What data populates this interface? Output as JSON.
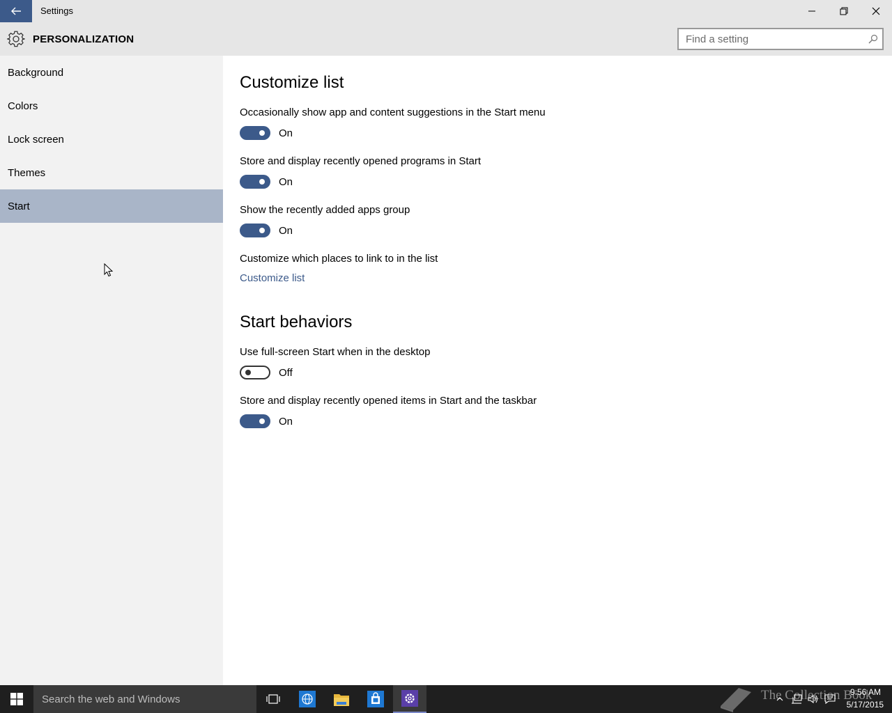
{
  "window": {
    "title": "Settings"
  },
  "header": {
    "title": "PERSONALIZATION",
    "search_placeholder": "Find a setting"
  },
  "sidebar": {
    "items": [
      {
        "label": "Background"
      },
      {
        "label": "Colors"
      },
      {
        "label": "Lock screen"
      },
      {
        "label": "Themes"
      },
      {
        "label": "Start",
        "selected": true
      }
    ]
  },
  "main": {
    "customize_list": {
      "title": "Customize list",
      "settings": [
        {
          "label": "Occasionally show app and content suggestions in the Start menu",
          "state": "On"
        },
        {
          "label": "Store and display recently opened programs in Start",
          "state": "On"
        },
        {
          "label": "Show the recently added apps group",
          "state": "On"
        }
      ],
      "places_label": "Customize which places to link to in the list",
      "places_link": "Customize list"
    },
    "start_behaviors": {
      "title": "Start behaviors",
      "settings": [
        {
          "label": "Use full-screen Start when in the desktop",
          "state": "Off"
        },
        {
          "label": "Store and display recently opened items in Start and the taskbar",
          "state": "On"
        }
      ]
    }
  },
  "taskbar": {
    "search_placeholder": "Search the web and Windows",
    "watermark": "The Collection Book",
    "clock_time": "9:56 AM",
    "clock_date": "5/17/2015"
  },
  "colors": {
    "accent": "#3c5a8a",
    "sidebar_selected": "#a9b5c8",
    "chrome": "#e6e6e6",
    "taskbar": "#1f1f1f"
  }
}
